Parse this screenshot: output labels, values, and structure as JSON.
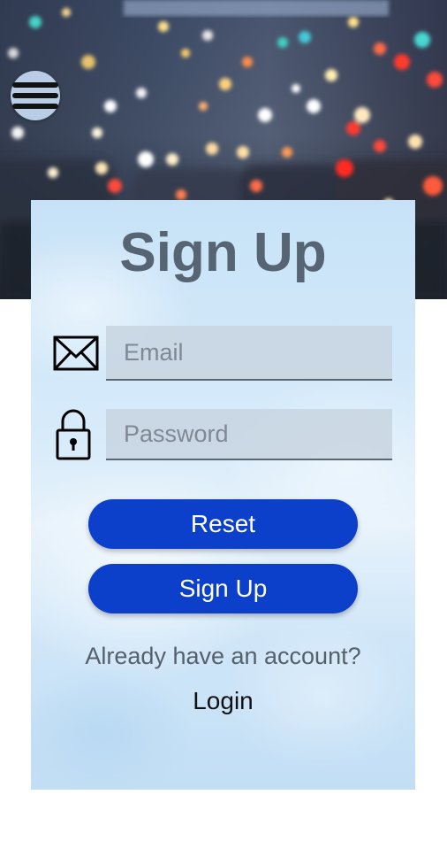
{
  "menu": {
    "icon": "hamburger-menu-icon"
  },
  "form": {
    "title": "Sign Up",
    "email": {
      "icon": "envelope-icon",
      "placeholder": "Email",
      "value": ""
    },
    "password": {
      "icon": "padlock-icon",
      "placeholder": "Password",
      "value": ""
    },
    "reset_label": "Reset",
    "signup_label": "Sign Up",
    "account_prompt": "Already have an account?",
    "login_label": "Login"
  },
  "colors": {
    "button": "#0c3fca",
    "title": "#566473",
    "card": "#d7ebfa",
    "menu_button": "#b9cde6"
  }
}
